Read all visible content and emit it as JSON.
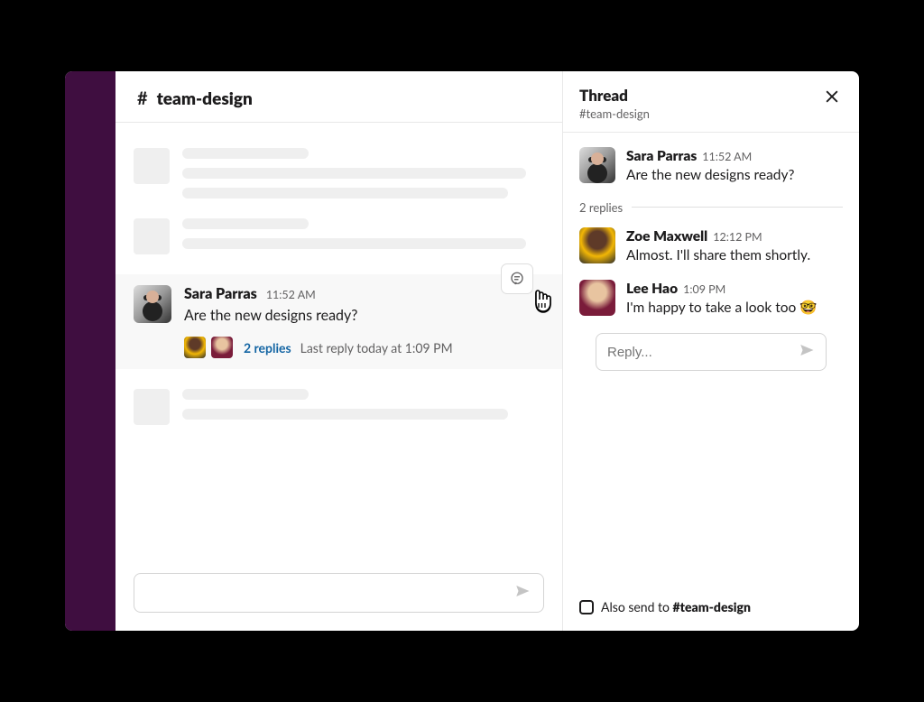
{
  "channel": {
    "hash": "#",
    "name": "team-design"
  },
  "main_message": {
    "user": "Sara Parras",
    "time": "11:52 AM",
    "text": "Are the new designs ready?",
    "replies_label": "2 replies",
    "last_reply": "Last reply today at 1:09 PM"
  },
  "composer": {
    "placeholder": ""
  },
  "thread": {
    "title": "Thread",
    "subtitle": "#team-design",
    "replies_divider": "2 replies",
    "messages": [
      {
        "user": "Sara Parras",
        "time": "11:52 AM",
        "text": "Are the new designs ready?"
      },
      {
        "user": "Zoe Maxwell",
        "time": "12:12 PM",
        "text": "Almost. I'll share them shortly."
      },
      {
        "user": "Lee Hao",
        "time": "1:09 PM",
        "text": "I'm happy to take a look too 🤓"
      }
    ],
    "reply_placeholder": "Reply...",
    "also_send_prefix": "Also send to ",
    "also_send_channel": "#team-design"
  }
}
